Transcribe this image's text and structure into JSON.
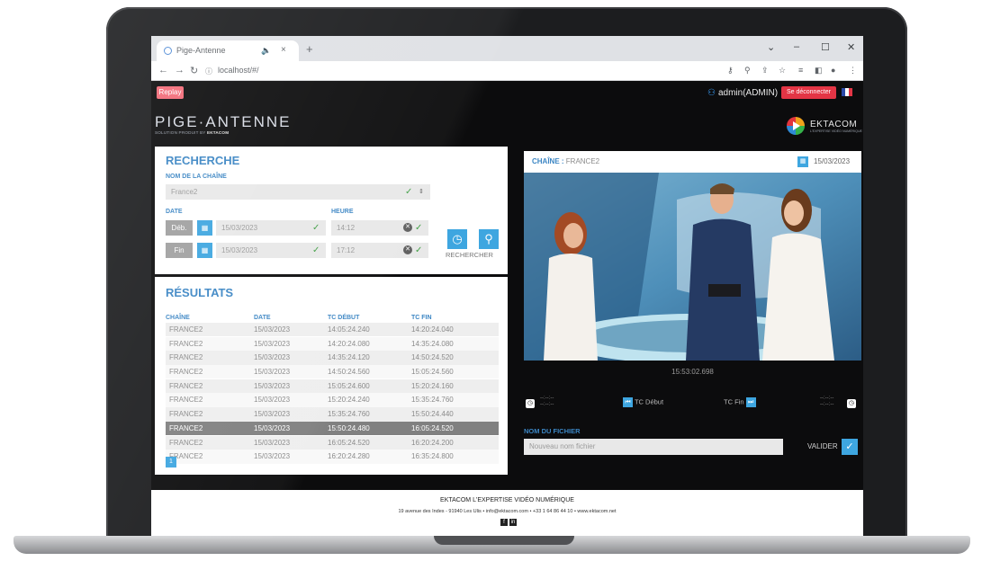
{
  "browser": {
    "tab_title": "Pige-Antenne",
    "url": "localhost/#/",
    "new_tab": "+",
    "audio_icon": "speaker-icon",
    "close_tab": "×",
    "minimize": "–",
    "maximize": "☐",
    "close": "✕"
  },
  "header": {
    "replay_label": "Replay",
    "user_label": "admin(ADMIN)",
    "logout_label": "Se déconnecter",
    "brand": "PIGE·ANTENNE",
    "brand_sub_prefix": "SOLUTION PRODUIT BY",
    "brand_sub_company": "EKTACOM",
    "ektacom_logo_text": "EKTACOM",
    "ektacom_tagline": "L'EXPERTISE VIDÉO NUMÉRIQUE"
  },
  "search": {
    "title": "RECHERCHE",
    "channel_label": "NOM DE LA CHAÎNE",
    "channel_value": "France2",
    "date_label": "DATE",
    "time_label": "HEURE",
    "start_btn": "Déb.",
    "end_btn": "Fin",
    "start_date": "15/03/2023",
    "end_date": "15/03/2023",
    "start_time": "14:12",
    "end_time": "17:12",
    "search_label": "RECHERCHER"
  },
  "results": {
    "title": "RÉSULTATS",
    "columns": [
      "CHAÎNE",
      "DATE",
      "TC DÉBUT",
      "TC FIN"
    ],
    "rows": [
      [
        "FRANCE2",
        "15/03/2023",
        "14:05:24.240",
        "14:20:24.040"
      ],
      [
        "FRANCE2",
        "15/03/2023",
        "14:20:24.080",
        "14:35:24.080"
      ],
      [
        "FRANCE2",
        "15/03/2023",
        "14:35:24.120",
        "14:50:24.520"
      ],
      [
        "FRANCE2",
        "15/03/2023",
        "14:50:24.560",
        "15:05:24.560"
      ],
      [
        "FRANCE2",
        "15/03/2023",
        "15:05:24.600",
        "15:20:24.160"
      ],
      [
        "FRANCE2",
        "15/03/2023",
        "15:20:24.240",
        "15:35:24.760"
      ],
      [
        "FRANCE2",
        "15/03/2023",
        "15:35:24.760",
        "15:50:24.440"
      ],
      [
        "FRANCE2",
        "15/03/2023",
        "15:50:24.480",
        "16:05:24.520"
      ],
      [
        "FRANCE2",
        "15/03/2023",
        "16:05:24.520",
        "16:20:24.200"
      ],
      [
        "FRANCE2",
        "15/03/2023",
        "16:20:24.280",
        "16:35:24.800"
      ]
    ],
    "selected_row": 7,
    "page": "1"
  },
  "player": {
    "channel_label": "CHAÎNE",
    "channel_value": "FRANCE2",
    "date": "15/03/2023",
    "timecode": "15:53:02.698",
    "tc_start_label": "TC Début",
    "tc_end_label": "TC Fin",
    "empty_time": "--:--:--",
    "empty_ms": "--:--:--",
    "filename_label": "NOM DU FICHIER",
    "filename_placeholder": "Nouveau nom fichier",
    "validate_label": "VALIDER"
  },
  "footer": {
    "title": "EKTACOM L'EXPERTISE VIDÉO NUMÉRIQUE",
    "address": "19 avenue des Indes - 91940 Les Ulis • info@ektacom.com • +33 1 64 86 44 10 • www.ektacom.net",
    "social_icons": [
      "facebook-icon",
      "linkedin-icon"
    ]
  },
  "colors": {
    "accent": "#3ea6e0",
    "heading": "#3c86c4",
    "logout": "#e33545",
    "replay": "#f36b78"
  }
}
